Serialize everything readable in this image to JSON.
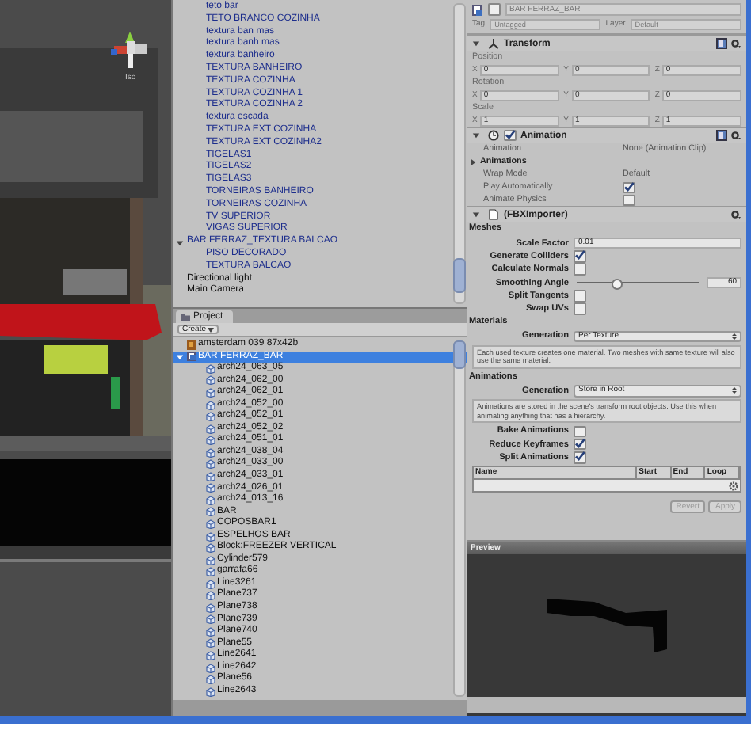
{
  "scene": {
    "projection_label": "Iso"
  },
  "hierarchy": {
    "continued_children": [
      {
        "label": "teto bar",
        "kind": "prefab",
        "selected": false
      },
      {
        "label": "TETO BRANCO COZINHA",
        "kind": "prefab",
        "selected": false
      },
      {
        "label": "textura ban mas",
        "kind": "prefab",
        "selected": false
      },
      {
        "label": "textura banh mas",
        "kind": "prefab",
        "selected": false
      },
      {
        "label": "textura banheiro",
        "kind": "prefab",
        "selected": false
      },
      {
        "label": "TEXTURA BANHEIRO",
        "kind": "prefab",
        "selected": false
      },
      {
        "label": "TEXTURA COZINHA",
        "kind": "prefab",
        "selected": false
      },
      {
        "label": "TEXTURA COZINHA 1",
        "kind": "prefab",
        "selected": false
      },
      {
        "label": "TEXTURA COZINHA 2",
        "kind": "prefab",
        "selected": false
      },
      {
        "label": "textura escada",
        "kind": "prefab",
        "selected": false
      },
      {
        "label": "TEXTURA EXT COZINHA",
        "kind": "prefab",
        "selected": false
      },
      {
        "label": "TEXTURA EXT COZINHA2",
        "kind": "prefab",
        "selected": false
      },
      {
        "label": "TIGELAS1",
        "kind": "prefab",
        "selected": false
      },
      {
        "label": "TIGELAS2",
        "kind": "prefab",
        "selected": false
      },
      {
        "label": "TIGELAS3",
        "kind": "prefab",
        "selected": false
      },
      {
        "label": "TORNEIRAS BANHEIRO",
        "kind": "prefab",
        "selected": false
      },
      {
        "label": "TORNEIRAS COZINHA",
        "kind": "prefab",
        "selected": false
      },
      {
        "label": "TV SUPERIOR",
        "kind": "prefab",
        "selected": false
      },
      {
        "label": "VIGAS SUPERIOR",
        "kind": "prefab",
        "selected": false
      }
    ],
    "items": [
      {
        "label": "BAR FERRAZ_TEXTURA BALCAO",
        "kind": "prefab",
        "selected": false,
        "expanded": true,
        "children": [
          {
            "label": "PISO DECORADO",
            "kind": "prefab",
            "selected": false
          },
          {
            "label": "TEXTURA BALCAO",
            "kind": "prefab",
            "selected": false
          }
        ]
      },
      {
        "label": "Directional light",
        "kind": "object",
        "selected": false
      },
      {
        "label": "Main Camera",
        "kind": "object",
        "selected": false
      }
    ]
  },
  "project": {
    "title": "Project",
    "create_label": "Create",
    "items": [
      {
        "label": "amsterdam 039 87x42b",
        "kind": "texture",
        "selected": false
      },
      {
        "label": "BAR FERRAZ_BAR",
        "kind": "model",
        "selected": true,
        "expanded": true,
        "children": [
          {
            "label": "arch24_063_05",
            "kind": "mesh",
            "selected": false
          },
          {
            "label": "arch24_062_00",
            "kind": "mesh",
            "selected": false
          },
          {
            "label": "arch24_062_01",
            "kind": "mesh",
            "selected": false
          },
          {
            "label": "arch24_052_00",
            "kind": "mesh",
            "selected": false
          },
          {
            "label": "arch24_052_01",
            "kind": "mesh",
            "selected": false
          },
          {
            "label": "arch24_052_02",
            "kind": "mesh",
            "selected": false
          },
          {
            "label": "arch24_051_01",
            "kind": "mesh",
            "selected": false
          },
          {
            "label": "arch24_038_04",
            "kind": "mesh",
            "selected": false
          },
          {
            "label": "arch24_033_00",
            "kind": "mesh",
            "selected": false
          },
          {
            "label": "arch24_033_01",
            "kind": "mesh",
            "selected": false
          },
          {
            "label": "arch24_026_01",
            "kind": "mesh",
            "selected": false
          },
          {
            "label": "arch24_013_16",
            "kind": "mesh",
            "selected": false
          },
          {
            "label": "BAR",
            "kind": "mesh",
            "selected": false
          },
          {
            "label": "COPOSBAR1",
            "kind": "mesh",
            "selected": false
          },
          {
            "label": "ESPELHOS BAR",
            "kind": "mesh",
            "selected": false
          },
          {
            "label": "Block:FREEZER VERTICAL",
            "kind": "mesh",
            "selected": false
          },
          {
            "label": "Cylinder579",
            "kind": "mesh",
            "selected": false
          },
          {
            "label": "garrafa66",
            "kind": "mesh",
            "selected": false
          },
          {
            "label": "Line3261",
            "kind": "mesh",
            "selected": false
          },
          {
            "label": "Plane737",
            "kind": "mesh",
            "selected": false
          },
          {
            "label": "Plane738",
            "kind": "mesh",
            "selected": false
          },
          {
            "label": "Plane739",
            "kind": "mesh",
            "selected": false
          },
          {
            "label": "Plane740",
            "kind": "mesh",
            "selected": false
          },
          {
            "label": "Plane55",
            "kind": "mesh",
            "selected": false
          },
          {
            "label": "Line2641",
            "kind": "mesh",
            "selected": false
          },
          {
            "label": "Line2642",
            "kind": "mesh",
            "selected": false
          },
          {
            "label": "Plane56",
            "kind": "mesh",
            "selected": false
          },
          {
            "label": "Line2643",
            "kind": "mesh",
            "selected": false
          }
        ]
      }
    ]
  },
  "inspector": {
    "object": {
      "name": "BAR FERRAZ_BAR",
      "active": false,
      "tag_label": "Tag",
      "tag": "Untagged",
      "layer_label": "Layer",
      "layer": "Default"
    },
    "transform": {
      "title": "Transform",
      "expanded": true,
      "groups": [
        {
          "label": "Position",
          "fields": [
            {
              "axis": "X",
              "value": "0"
            },
            {
              "axis": "Y",
              "value": "0"
            },
            {
              "axis": "Z",
              "value": "0"
            }
          ]
        },
        {
          "label": "Rotation",
          "fields": [
            {
              "axis": "X",
              "value": "0"
            },
            {
              "axis": "Y",
              "value": "0"
            },
            {
              "axis": "Z",
              "value": "0"
            }
          ]
        },
        {
          "label": "Scale",
          "fields": [
            {
              "axis": "X",
              "value": "1"
            },
            {
              "axis": "Y",
              "value": "1"
            },
            {
              "axis": "Z",
              "value": "1"
            }
          ]
        }
      ]
    },
    "animation": {
      "title": "Animation",
      "enabled": true,
      "expanded": true,
      "rows": [
        {
          "kind": "object_field",
          "label": "Animation",
          "value": "None (Animation Clip)"
        },
        {
          "kind": "foldout",
          "label": "Animations",
          "expanded": false
        },
        {
          "kind": "dropdown",
          "label": "Wrap Mode",
          "value": "Default"
        },
        {
          "kind": "checkbox",
          "label": "Play Automatically",
          "checked": true
        },
        {
          "kind": "checkbox",
          "label": "Animate Physics",
          "checked": false
        }
      ]
    },
    "importer": {
      "title": "(FBXImporter)",
      "expanded": true,
      "sections": [
        {
          "heading": "Meshes",
          "rows": [
            {
              "kind": "text",
              "label": "Scale Factor",
              "value": "0.01"
            },
            {
              "kind": "checkbox",
              "label": "Generate Colliders",
              "checked": true
            },
            {
              "kind": "checkbox",
              "label": "Calculate Normals",
              "checked": false
            },
            {
              "kind": "slider",
              "label": "Smoothing Angle",
              "level": 0.33,
              "value": "60"
            },
            {
              "kind": "checkbox",
              "label": "Split Tangents",
              "checked": false
            },
            {
              "kind": "checkbox",
              "label": "Swap UVs",
              "checked": false
            }
          ]
        },
        {
          "heading": "Materials",
          "rows": [
            {
              "kind": "dropdown",
              "label": "Generation",
              "value": "Per Texture"
            },
            {
              "kind": "help",
              "text": "Each used texture creates one material. Two meshes with same texture will also use the same material."
            }
          ]
        },
        {
          "heading": "Animations",
          "rows": [
            {
              "kind": "dropdown",
              "label": "Generation",
              "value": "Store in Root"
            },
            {
              "kind": "help",
              "text": "Animations are stored in the scene's transform root objects. Use this when animating anything that has a hierarchy."
            },
            {
              "kind": "checkbox",
              "label": "Bake Animations",
              "checked": false
            },
            {
              "kind": "checkbox",
              "label": "Reduce Keyframes",
              "checked": true
            },
            {
              "kind": "checkbox",
              "label": "Split Animations",
              "checked": true
            },
            {
              "kind": "clip_table",
              "columns": [
                "Name",
                "Start",
                "End",
                "Loop"
              ]
            }
          ]
        }
      ],
      "buttons": [
        {
          "label": "Revert",
          "disabled": true
        },
        {
          "label": "Apply",
          "disabled": true
        }
      ]
    }
  },
  "preview": {
    "title": "Preview"
  }
}
